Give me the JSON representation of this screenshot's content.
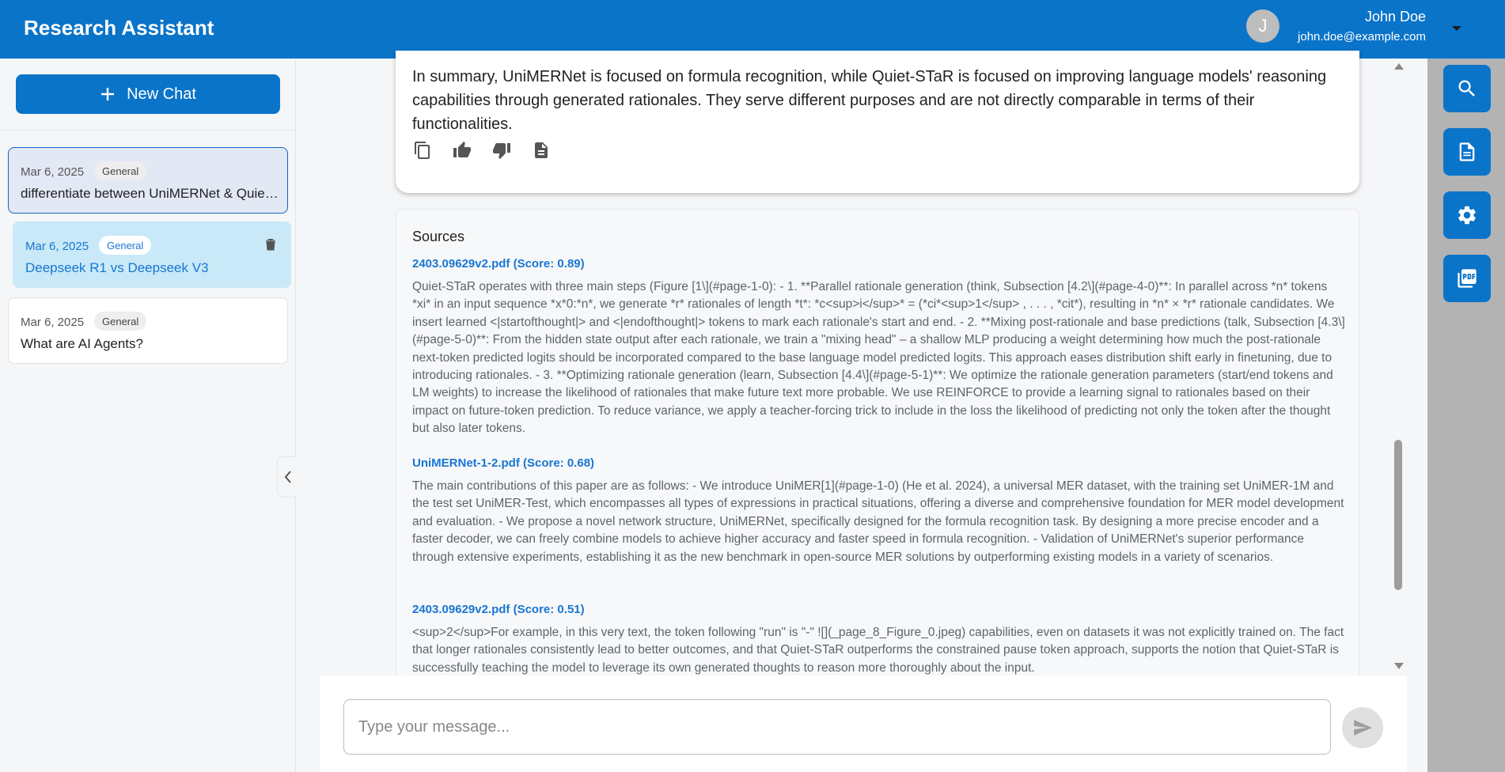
{
  "header": {
    "app_title": "Research Assistant",
    "user": {
      "initial": "J",
      "name": "John Doe",
      "email": "john.doe@example.com"
    }
  },
  "sidebar": {
    "new_chat_label": "New Chat",
    "chats": [
      {
        "date": "Mar 6, 2025",
        "tag": "General",
        "title": "differentiate between UniMERNet & Quiet-STaR",
        "state": "active"
      },
      {
        "date": "Mar 6, 2025",
        "tag": "General",
        "title": "Deepseek R1 vs Deepseek V3",
        "state": "hover"
      },
      {
        "date": "Mar 6, 2025",
        "tag": "General",
        "title": "What are AI Agents?",
        "state": "normal"
      }
    ]
  },
  "answer": {
    "text": "In summary, UniMERNet is focused on formula recognition, while Quiet-STaR is focused on improving language models' reasoning capabilities through generated rationales. They serve different purposes and are not directly comparable in terms of their functionalities."
  },
  "sources": {
    "title": "Sources",
    "items": [
      {
        "file": "2403.09629v2.pdf (Score: 0.89)",
        "text": "Quiet-STaR operates with three main steps (Figure [1\\](#page-1-0): - 1. **Parallel rationale generation (think, Subsection [4.2\\](#page-4-0)**: In parallel across *n* tokens *xi* in an input sequence *x*0:*n*, we generate *r* rationales of length *t*: *c<sup>i</sup>* = (*ci*<sup>1</sup> , . . . , *cit*), resulting in *n* × *r* rationale candidates. We insert learned <|startofthought|> and <|endofthought|> tokens to mark each rationale's start and end. - 2. **Mixing post-rationale and base predictions (talk, Subsection [4.3\\](#page-5-0)**: From the hidden state output after each rationale, we train a \"mixing head\" – a shallow MLP producing a weight determining how much the post-rationale next-token predicted logits should be incorporated compared to the base language model predicted logits. This approach eases distribution shift early in finetuning, due to introducing rationales. - 3. **Optimizing rationale generation (learn, Subsection [4.4\\](#page-5-1)**: We optimize the rationale generation parameters (start/end tokens and LM weights) to increase the likelihood of rationales that make future text more probable. We use REINFORCE to provide a learning signal to rationales based on their impact on future-token prediction. To reduce variance, we apply a teacher-forcing trick to include in the loss the likelihood of predicting not only the token after the thought but also later tokens."
      },
      {
        "file": "UniMERNet-1-2.pdf (Score: 0.68)",
        "text": "The main contributions of this paper are as follows: - We introduce UniMER[1](#page-1-0) (He et al. 2024), a universal MER dataset, with the training set UniMER-1M and the test set UniMER-Test, which encompasses all types of expressions in practical situations, offering a diverse and comprehensive foundation for MER model development and evaluation. - We propose a novel network structure, UniMERNet, specifically designed for the formula recognition task. By designing a more precise encoder and a faster decoder, we can freely combine models to achieve higher accuracy and faster speed in formula recognition. - Validation of UniMERNet's superior performance through extensive experiments, establishing it as the new benchmark in open-source MER solutions by outperforming existing models in a variety of scenarios."
      },
      {
        "file": "2403.09629v2.pdf (Score: 0.51)",
        "text": "<sup>2</sup>For example, in this very text, the token following \"run\" is \"-\" ![](_page_8_Figure_0.jpeg) capabilities, even on datasets it was not explicitly trained on. The fact that longer rationales consistently lead to better outcomes, and that Quiet-STaR outperforms the constrained pause token approach, supports the notion that Quiet-STaR is successfully teaching the model to leverage its own generated thoughts to reason more thoroughly about the input."
      }
    ]
  },
  "composer": {
    "placeholder": "Type your message..."
  },
  "right_rail": {
    "buttons": [
      "search-icon",
      "document-icon",
      "gear-icon",
      "pdf-icon"
    ]
  },
  "colors": {
    "brand": "#0a74c9",
    "link": "#1976d2",
    "hover_bg": "#c9e9f8",
    "active_bg": "#e3e8f5"
  }
}
